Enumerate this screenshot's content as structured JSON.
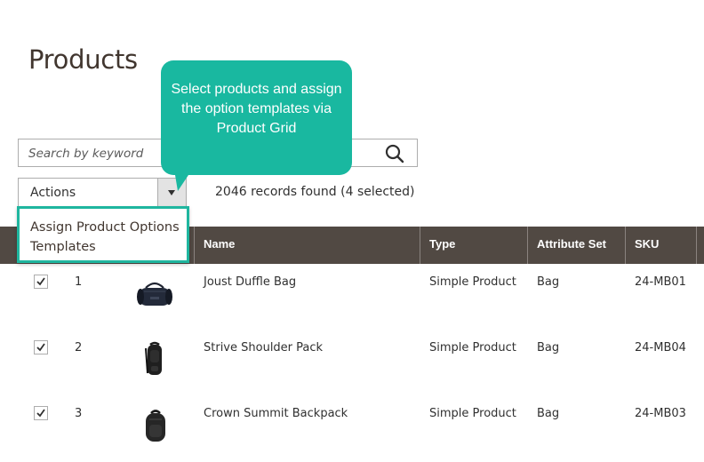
{
  "page": {
    "title": "Products"
  },
  "search": {
    "placeholder": "Search by keyword",
    "button_icon": "search-icon"
  },
  "actions": {
    "label": "Actions",
    "toggle_icon": "caret-down-icon"
  },
  "records": {
    "text": "2046 records found (4 selected)"
  },
  "dropdown": {
    "items": [
      {
        "label": "Assign Product Options Templates"
      }
    ]
  },
  "callout": {
    "text": "Select products and assign the option templates via Product Grid"
  },
  "grid": {
    "columns": [
      "Name",
      "Type",
      "Attribute Set",
      "SKU"
    ],
    "rows": [
      {
        "checked": true,
        "id": "1",
        "thumbnail": "duffle-bag-icon",
        "name": "Joust Duffle Bag",
        "type": "Simple Product",
        "attribute_set": "Bag",
        "sku": "24-MB01"
      },
      {
        "checked": true,
        "id": "2",
        "thumbnail": "shoulder-pack-icon",
        "name": "Strive Shoulder Pack",
        "type": "Simple Product",
        "attribute_set": "Bag",
        "sku": "24-MB04"
      },
      {
        "checked": true,
        "id": "3",
        "thumbnail": "backpack-icon",
        "name": "Crown Summit Backpack",
        "type": "Simple Product",
        "attribute_set": "Bag",
        "sku": "24-MB03"
      }
    ]
  },
  "colors": {
    "header_bg": "#514943",
    "accent": "#19b8a0",
    "title": "#41362f"
  }
}
